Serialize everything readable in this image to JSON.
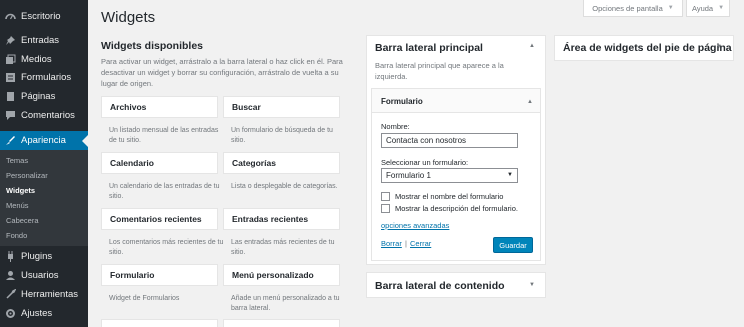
{
  "nav": {
    "items": [
      {
        "label": "Escritorio",
        "icon": "dashboard-icon"
      },
      {
        "label": "Entradas",
        "icon": "pin-icon"
      },
      {
        "label": "Medios",
        "icon": "media-icon"
      },
      {
        "label": "Formularios",
        "icon": "forms-icon"
      },
      {
        "label": "Páginas",
        "icon": "pages-icon"
      },
      {
        "label": "Comentarios",
        "icon": "comments-icon"
      },
      {
        "label": "Apariencia",
        "icon": "brush-icon"
      },
      {
        "label": "Plugins",
        "icon": "plugins-icon"
      },
      {
        "label": "Usuarios",
        "icon": "users-icon"
      },
      {
        "label": "Herramientas",
        "icon": "tools-icon"
      },
      {
        "label": "Ajustes",
        "icon": "settings-icon"
      }
    ],
    "submenu": [
      "Temas",
      "Personalizar",
      "Widgets",
      "Menús",
      "Cabecera",
      "Fondo"
    ],
    "active_color": "#0073aa"
  },
  "top": {
    "screen_options": "Opciones de pantalla",
    "help": "Ayuda"
  },
  "page": {
    "title": "Widgets"
  },
  "available": {
    "title": "Widgets disponibles",
    "description": "Para activar un widget, arrástralo a la barra lateral o haz click en él. Para desactivar un widget y borrar su configuración, arrástralo de vuelta a su lugar de origen.",
    "widgets": [
      {
        "name": "Archivos",
        "desc": "Un listado mensual de las entradas de tu sitio."
      },
      {
        "name": "Buscar",
        "desc": "Un formulario de búsqueda de tu sitio."
      },
      {
        "name": "Calendario",
        "desc": "Un calendario de las entradas de tu sitio."
      },
      {
        "name": "Categorías",
        "desc": "Lista o desplegable de categorías."
      },
      {
        "name": "Comentarios recientes",
        "desc": "Los comentarios más recientes de tu sitio."
      },
      {
        "name": "Entradas recientes",
        "desc": "Las entradas más recientes de tu sitio."
      },
      {
        "name": "Formulario",
        "desc": "Widget de Formularios"
      },
      {
        "name": "Menú personalizado",
        "desc": "Añade un menú personalizado a tu barra lateral."
      }
    ]
  },
  "main_sidebar": {
    "title": "Barra lateral principal",
    "description": "Barra lateral principal que aparece a la izquierda.",
    "form_widget": {
      "title": "Formulario",
      "name_label": "Nombre:",
      "name_value": "Contacta con nosotros",
      "select_label": "Seleccionar un formulario:",
      "select_value": "Formulario 1",
      "check1": "Mostrar el nombre del formulario",
      "check2": "Mostrar la descripción del formulario.",
      "advanced": "opciones avanzadas",
      "delete": "Borrar",
      "separator": "|",
      "close": "Cerrar",
      "save": "Guardar"
    }
  },
  "content_sidebar": {
    "title": "Barra lateral de contenido"
  },
  "footer_area": {
    "title": "Área de widgets del pie de página"
  }
}
